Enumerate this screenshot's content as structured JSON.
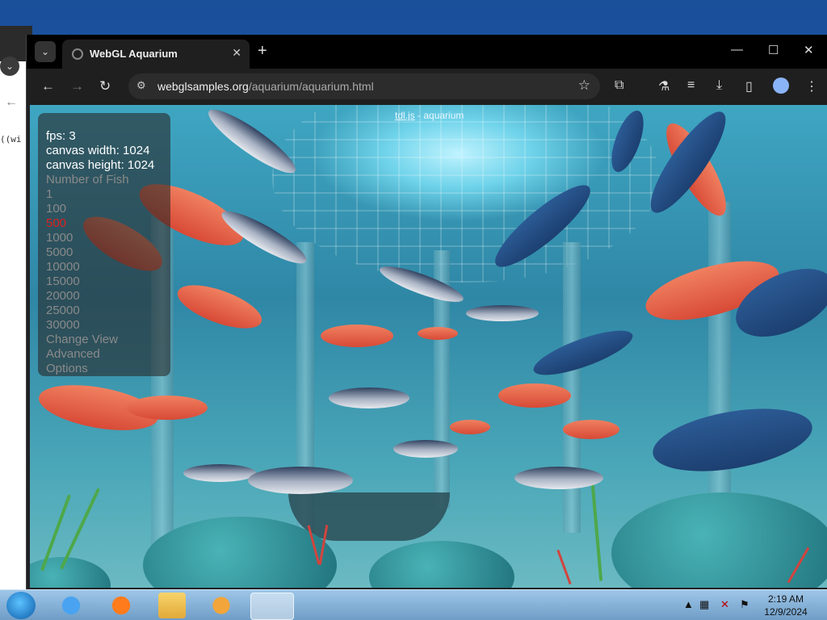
{
  "background_window": {
    "code_snippet": "((wi"
  },
  "browser": {
    "tab_title": "WebGL Aquarium",
    "url_host": "webglsamples.org",
    "url_path": "/aquarium/aquarium.html"
  },
  "page": {
    "title_link": "tdl.js",
    "title_rest": " - aquarium"
  },
  "overlay": {
    "fps_label": "fps: 3",
    "canvas_width": "canvas width: 1024",
    "canvas_height": "canvas height: 1024",
    "number_of_fish_label": "Number of Fish",
    "fish_options": [
      "1",
      "100",
      "500",
      "1000",
      "5000",
      "10000",
      "15000",
      "20000",
      "25000",
      "30000"
    ],
    "selected_fish_option": "500",
    "change_view": "Change View",
    "advanced": "Advanced",
    "options": "Options"
  },
  "taskbar": {
    "time": "2:19 AM",
    "date": "12/9/2024"
  },
  "colors": {
    "selected_option": "#e02020",
    "unselected_option": "#8a8a8a"
  }
}
